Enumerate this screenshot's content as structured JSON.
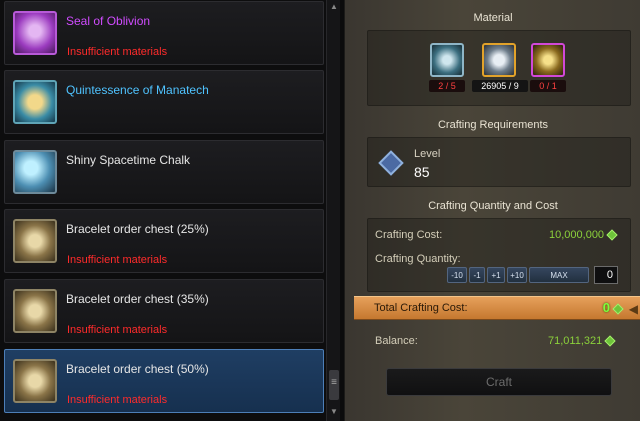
{
  "recipes": [
    {
      "name": "Seal of Oblivion",
      "warning": "Insufficient materials",
      "name_color": "#d04cff",
      "icon": "scroll-icon",
      "icon_color": "#9b3bbf"
    },
    {
      "name": "Quintessence of Manatech",
      "warning": "",
      "name_color": "#4fc3ff",
      "icon": "chest-icon",
      "icon_color": "#2d6f86"
    },
    {
      "name": "Shiny Spacetime Chalk",
      "warning": "",
      "name_color": "#e6e6e6",
      "icon": "chalk-icon",
      "icon_color": "#2f5f7a"
    },
    {
      "name": "Bracelet order chest (25%)",
      "warning": "Insufficient materials",
      "name_color": "#e6e6e6",
      "icon": "bracelet-chest-icon",
      "icon_color": "#6a5a3a"
    },
    {
      "name": "Bracelet order chest (35%)",
      "warning": "Insufficient materials",
      "name_color": "#e6e6e6",
      "icon": "bracelet-chest-icon",
      "icon_color": "#6a5a3a"
    },
    {
      "name": "Bracelet order chest (50%)",
      "warning": "Insufficient materials",
      "name_color": "#e6e6e6",
      "icon": "bracelet-chest-icon",
      "icon_color": "#6a5a3a"
    }
  ],
  "material": {
    "title": "Material",
    "items": [
      {
        "icon": "bracer-material-icon",
        "count": "2 / 5",
        "border": "#8fb6c7",
        "count_color": "#ff4040"
      },
      {
        "icon": "ring-material-icon",
        "count": "26905 / 9",
        "border": "#e2a22a",
        "count_color": "#ffffff"
      },
      {
        "icon": "gold-ring-material-icon",
        "count": "0 / 1",
        "border": "#d248d8",
        "count_color": "#ff4040"
      }
    ]
  },
  "requirements": {
    "title": "Crafting Requirements",
    "level_label": "Level",
    "level_value": "85"
  },
  "quantity": {
    "title": "Crafting Quantity and Cost",
    "cost_label": "Crafting Cost:",
    "cost_value": "10,000,000",
    "qty_label": "Crafting Quantity:",
    "buttons": [
      "-10",
      "-1",
      "+1",
      "+10",
      "MAX"
    ],
    "qty_value": "0"
  },
  "total": {
    "label": "Total Crafting Cost:",
    "value": "0"
  },
  "balance": {
    "label": "Balance:",
    "value": "71,011,321"
  },
  "craft_label": "Craft",
  "selected_index": 5
}
